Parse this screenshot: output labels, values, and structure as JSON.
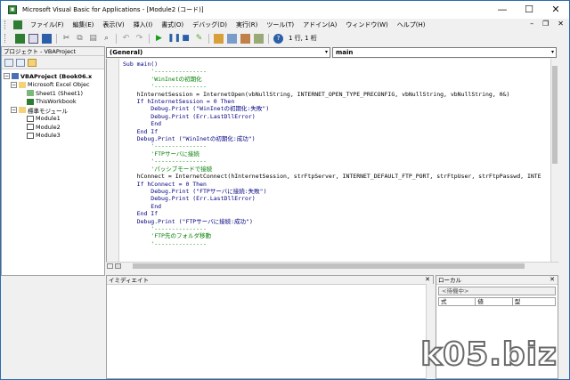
{
  "window": {
    "title": "Microsoft Visual Basic for Applications - [Module2 (コード)]",
    "controls": {
      "minimize": "—",
      "maximize": "☐",
      "close": "✕"
    }
  },
  "menu": {
    "items": [
      "ファイル(F)",
      "編集(E)",
      "表示(V)",
      "挿入(I)",
      "書式(O)",
      "デバッグ(D)",
      "実行(R)",
      "ツール(T)",
      "アドイン(A)",
      "ウィンドウ(W)",
      "ヘルプ(H)"
    ],
    "mdi_controls": [
      "–",
      "❐",
      "✕"
    ]
  },
  "toolbar": {
    "position": "1 行, 1 桁",
    "icons": [
      "excel-icon",
      "insert-module-icon",
      "save-icon",
      "cut-icon",
      "copy-icon",
      "paste-icon",
      "find-icon",
      "undo-icon",
      "redo-icon",
      "run-icon",
      "break-icon",
      "reset-icon",
      "design-mode-icon",
      "project-explorer-icon",
      "properties-icon",
      "object-browser-icon",
      "toolbox-icon",
      "help-icon"
    ]
  },
  "project": {
    "title": "プロジェクト - VBAProject",
    "tree": [
      {
        "label": "VBAProject (Book06.x",
        "bold": true
      },
      {
        "label": "Microsoft Excel Objec"
      },
      {
        "label": "Sheet1 (Sheet1)"
      },
      {
        "label": "ThisWorkbook"
      },
      {
        "label": "標準モジュール"
      },
      {
        "label": "Module1"
      },
      {
        "label": "Module2"
      },
      {
        "label": "Module3"
      }
    ]
  },
  "code_pane": {
    "object_combo": "(General)",
    "proc_combo": "main",
    "lines": [
      {
        "text": "Sub main()",
        "type": "kw"
      },
      {
        "text": "        '---------------",
        "type": "cm"
      },
      {
        "text": "        'WinInetの初期化",
        "type": "cm"
      },
      {
        "text": "        '---------------",
        "type": "cm"
      },
      {
        "text": "    hInternetSession = InternetOpen(vbNullString, INTERNET_OPEN_TYPE_PRECONFIG, vbNullString, vbNullString, 0&)",
        "type": "plain"
      },
      {
        "text": "",
        "type": "plain"
      },
      {
        "text": "    If hInternetSession = 0 Then",
        "type": "kw"
      },
      {
        "text": "        Debug.Print (\"WinInetの初期化:失敗\")",
        "type": "kw"
      },
      {
        "text": "        Debug.Print (Err.LastDllError)",
        "type": "kw"
      },
      {
        "text": "        End",
        "type": "kw"
      },
      {
        "text": "    End If",
        "type": "kw"
      },
      {
        "text": "    Debug.Print (\"WinInetの初期化:成功\")",
        "type": "kw"
      },
      {
        "text": "",
        "type": "plain"
      },
      {
        "text": "",
        "type": "plain"
      },
      {
        "text": "        '---------------",
        "type": "cm"
      },
      {
        "text": "        'FTPサーバに接続",
        "type": "cm"
      },
      {
        "text": "        '---------------",
        "type": "cm"
      },
      {
        "text": "        'パッシブモードで接続",
        "type": "cm"
      },
      {
        "text": "    hConnect = InternetConnect(hInternetSession, strFtpServer, INTERNET_DEFAULT_FTP_PORT, strFtpUser, strFtpPasswd, INTE",
        "type": "plain"
      },
      {
        "text": "    If hConnect = 0 Then",
        "type": "kw"
      },
      {
        "text": "        Debug.Print (\"FTPサーバに接続:失敗\")",
        "type": "kw"
      },
      {
        "text": "        Debug.Print (Err.LastDllError)",
        "type": "kw"
      },
      {
        "text": "        End",
        "type": "kw"
      },
      {
        "text": "    End If",
        "type": "kw"
      },
      {
        "text": "    Debug.Print (\"FTPサーバに接続:成功\")",
        "type": "kw"
      },
      {
        "text": "",
        "type": "plain"
      },
      {
        "text": "",
        "type": "plain"
      },
      {
        "text": "        '---------------",
        "type": "cm"
      },
      {
        "text": "        'FTP先のフォルダ移動",
        "type": "cm"
      },
      {
        "text": "        '---------------",
        "type": "cm"
      }
    ]
  },
  "immediate": {
    "title": "イミディエイト"
  },
  "locals": {
    "title": "ローカル",
    "status": "<待機中>",
    "columns": [
      "式",
      "値",
      "型"
    ]
  },
  "watermark": "k05.biz"
}
